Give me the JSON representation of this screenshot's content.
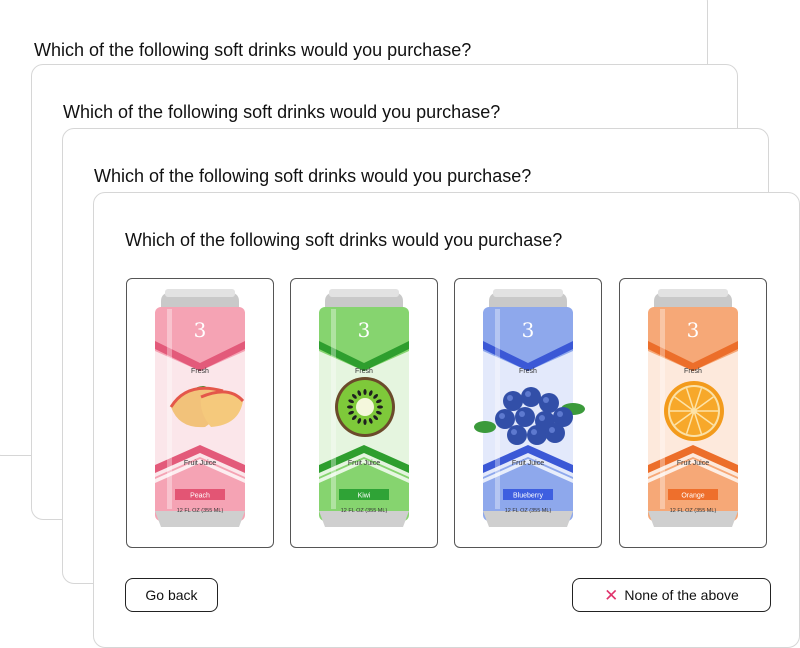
{
  "question": "Which of the following soft drinks would you purchase?",
  "options": [
    {
      "name": "peach",
      "label": "Fresh",
      "sublabel": "Fruit Juice",
      "flavor": "Peach",
      "volume": "12 FL OZ (355 ML)",
      "logo": "3",
      "colors": {
        "main": "#f5a3b4",
        "dark": "#e35a7a",
        "light": "#fbe6ea",
        "tag": "#e35574"
      },
      "fruit_icon": "peach-slices-icon"
    },
    {
      "name": "kiwi",
      "label": "Fresh",
      "sublabel": "Fruit Juice",
      "flavor": "Kiwi",
      "volume": "12 FL OZ (355 ML)",
      "logo": "3",
      "colors": {
        "main": "#86d46f",
        "dark": "#2e9e2e",
        "light": "#e5f5df",
        "tag": "#2fa336"
      },
      "fruit_icon": "kiwi-slice-icon"
    },
    {
      "name": "blueberry",
      "label": "Fresh",
      "sublabel": "Fruit Juice",
      "flavor": "Blueberry",
      "volume": "12 FL OZ (355 ML)",
      "logo": "3",
      "colors": {
        "main": "#8ea8ec",
        "dark": "#3b58d6",
        "light": "#e3e9fb",
        "tag": "#3e5fe0"
      },
      "fruit_icon": "blueberries-icon"
    },
    {
      "name": "orange",
      "label": "Fresh",
      "sublabel": "Fruit Juice",
      "flavor": "Orange",
      "volume": "12 FL OZ (355 ML)",
      "logo": "3",
      "colors": {
        "main": "#f6a877",
        "dark": "#ec6e2a",
        "light": "#fde9dc",
        "tag": "#ee6f2c"
      },
      "fruit_icon": "orange-slice-icon"
    }
  ],
  "buttons": {
    "back": "Go back",
    "none": "None of the above",
    "none_icon": "close-x-icon",
    "none_icon_color": "#e0336c"
  }
}
